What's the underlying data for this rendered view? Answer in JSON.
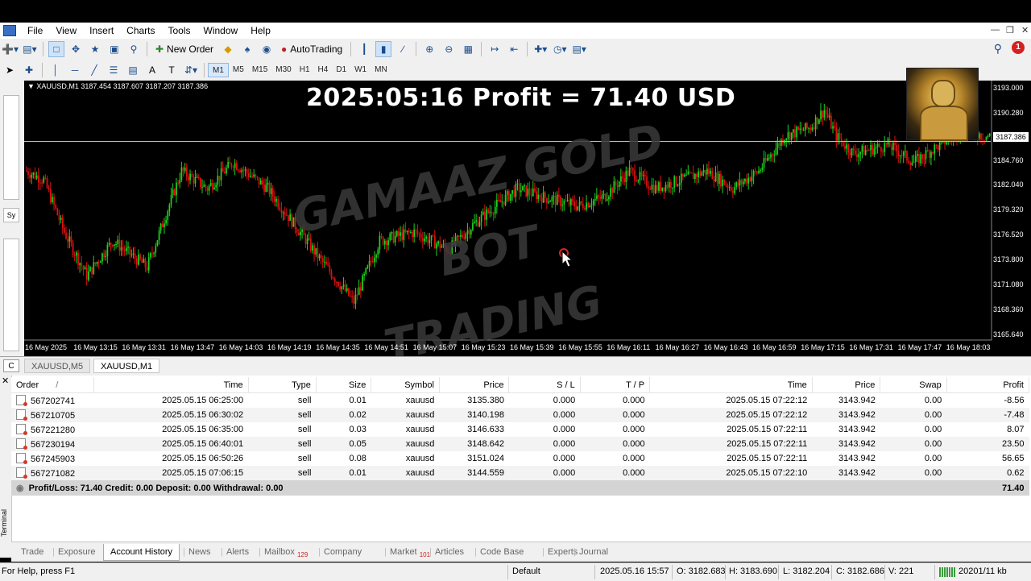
{
  "menu": {
    "items": [
      "File",
      "View",
      "Insert",
      "Charts",
      "Tools",
      "Window",
      "Help"
    ]
  },
  "toolbar": {
    "new_order_label": "New Order",
    "autotrading_label": "AutoTrading",
    "timeframes": [
      "M1",
      "M5",
      "M15",
      "M30",
      "H1",
      "H4",
      "D1",
      "W1",
      "MN"
    ],
    "active_timeframe": "M1",
    "alert_count": "1"
  },
  "chart": {
    "info": "▼ XAUUSD,M1  3187.454 3187.607 3187.207 3187.386",
    "overlay_title": "2025:05:16 Profit = 71.40 USD",
    "watermark": [
      "GAMAAZ GOLD",
      "BOT",
      "TRADING"
    ],
    "current_price": "3187.386",
    "price_labels": [
      "3193.000",
      "3190.280",
      "3187.386",
      "3184.760",
      "3182.040",
      "3179.320",
      "3176.520",
      "3173.800",
      "3171.080",
      "3168.360",
      "3165.640"
    ],
    "time_labels": [
      "16 May 2025",
      "16 May 13:15",
      "16 May 13:31",
      "16 May 13:47",
      "16 May 14:03",
      "16 May 14:19",
      "16 May 14:35",
      "16 May 14:51",
      "16 May 15:07",
      "16 May 15:23",
      "16 May 15:39",
      "16 May 15:55",
      "16 May 16:11",
      "16 May 16:27",
      "16 May 16:43",
      "16 May 16:59",
      "16 May 17:15",
      "16 May 17:31",
      "16 May 17:47",
      "16 May 18:03"
    ],
    "colors": {
      "bull": "#1fd31f",
      "bear": "#e01010",
      "background": "#000000"
    }
  },
  "chart_tabs": [
    "XAUUSD,M5",
    "XAUUSD,M1"
  ],
  "chart_tabs_active": "XAUUSD,M1",
  "terminal": {
    "side_label": "Terminal",
    "headers": [
      "Order",
      "Time",
      "Type",
      "Size",
      "Symbol",
      "Price",
      "S / L",
      "T / P",
      "Time",
      "Price",
      "Swap",
      "Profit"
    ],
    "order_sort_marker": "/",
    "rows": [
      [
        "567202741",
        "2025.05.15 06:25:00",
        "sell",
        "0.01",
        "xauusd",
        "3135.380",
        "0.000",
        "0.000",
        "2025.05.15 07:22:12",
        "3143.942",
        "0.00",
        "-8.56"
      ],
      [
        "567210705",
        "2025.05.15 06:30:02",
        "sell",
        "0.02",
        "xauusd",
        "3140.198",
        "0.000",
        "0.000",
        "2025.05.15 07:22:12",
        "3143.942",
        "0.00",
        "-7.48"
      ],
      [
        "567221280",
        "2025.05.15 06:35:00",
        "sell",
        "0.03",
        "xauusd",
        "3146.633",
        "0.000",
        "0.000",
        "2025.05.15 07:22:11",
        "3143.942",
        "0.00",
        "8.07"
      ],
      [
        "567230194",
        "2025.05.15 06:40:01",
        "sell",
        "0.05",
        "xauusd",
        "3148.642",
        "0.000",
        "0.000",
        "2025.05.15 07:22:11",
        "3143.942",
        "0.00",
        "23.50"
      ],
      [
        "567245903",
        "2025.05.15 06:50:26",
        "sell",
        "0.08",
        "xauusd",
        "3151.024",
        "0.000",
        "0.000",
        "2025.05.15 07:22:11",
        "3143.942",
        "0.00",
        "56.65"
      ],
      [
        "567271082",
        "2025.05.15 07:06:15",
        "sell",
        "0.01",
        "xauusd",
        "3144.559",
        "0.000",
        "0.000",
        "2025.05.15 07:22:10",
        "3143.942",
        "0.00",
        "0.62"
      ]
    ],
    "summary_text": "Profit/Loss: 71.40  Credit: 0.00  Deposit: 0.00  Withdrawal: 0.00",
    "summary_total": "71.40",
    "tabs": [
      {
        "label": "Trade"
      },
      {
        "label": "Exposure"
      },
      {
        "label": "Account History",
        "active": true
      },
      {
        "label": "News"
      },
      {
        "label": "Alerts"
      },
      {
        "label": "Mailbox",
        "badge": "129"
      },
      {
        "label": "Company"
      },
      {
        "label": "Market",
        "badge": "101"
      },
      {
        "label": "Articles"
      },
      {
        "label": "Code Base"
      },
      {
        "label": "Experts"
      },
      {
        "label": "Journal"
      }
    ]
  },
  "status": {
    "help": "For Help, press F1",
    "profile": "Default",
    "datetime": "2025.05.16 15:57",
    "open": "O: 3182.683",
    "high": "H: 3183.690",
    "low": "L: 3182.204",
    "close": "C: 3182.686",
    "volume": "V: 221",
    "traffic": "20201/11 kb"
  }
}
